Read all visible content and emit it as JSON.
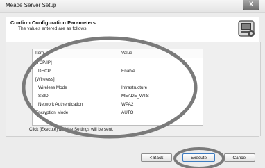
{
  "window": {
    "title": "Meade Server Setup",
    "close_glyph": "X"
  },
  "header": {
    "title": "Confirm Configuration Parameters",
    "subtitle": "The values entered are as follows:",
    "icon": "computer-settings-icon"
  },
  "table": {
    "columns": [
      "Item",
      "Value"
    ],
    "rows": [
      {
        "item": "[TCP/IP]",
        "value": ""
      },
      {
        "item": "DHCP",
        "value": "Enable"
      },
      {
        "item": "[Wireless]",
        "value": ""
      },
      {
        "item": "Wireless Mode",
        "value": "Infrastructure"
      },
      {
        "item": "SSID",
        "value": "MEADE_WTS"
      },
      {
        "item": "Network Authentication",
        "value": "WPA2"
      },
      {
        "item": "Encryption Mode",
        "value": "AUTO"
      }
    ]
  },
  "footer_note": "Click [Execute] and the Settings will be sent.",
  "buttons": {
    "back": "< Back",
    "execute": "Execute",
    "cancel": "Cancel"
  },
  "colors": {
    "annotation_circle": "#7a7a7a",
    "execute_border": "#3d7bbf"
  }
}
